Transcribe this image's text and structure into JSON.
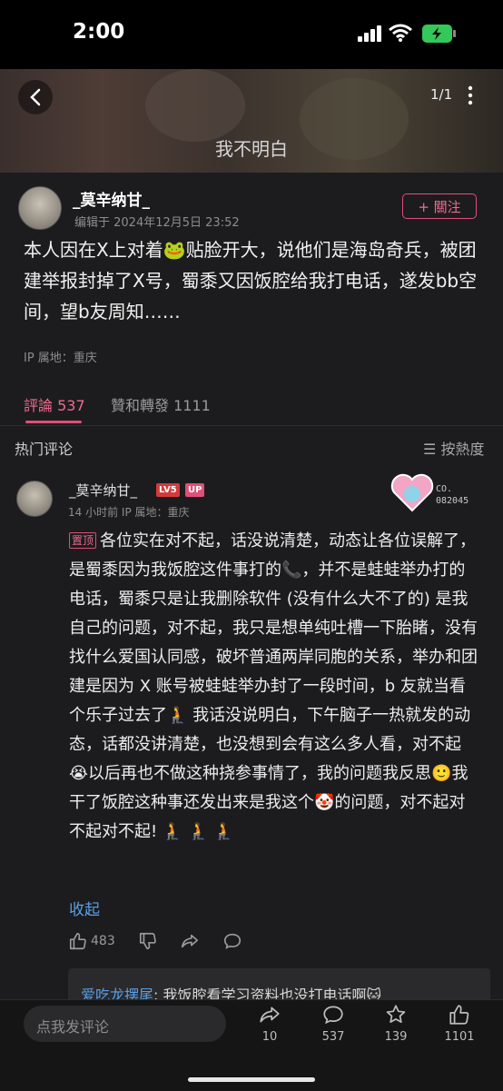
{
  "status_bar": {
    "time": "2:00"
  },
  "media": {
    "subtitle": "我不明白",
    "counter": "1/1"
  },
  "author": {
    "name": "_莫辛纳甘_",
    "edit_time": "编辑于 2024年12月5日 23:52",
    "follow_label": "+ 關注"
  },
  "post": {
    "text": "本人因在X上对着🐸贴脸开大，说他们是海岛奇兵，被团建举报封掉了X号，蜀黍又因饭腔给我打电话，遂发bb空间，望b友周知……",
    "ip": "IP 属地：重庆"
  },
  "tabs": {
    "comments": "評論 537",
    "likes_reposts": "贊和轉發 1111"
  },
  "hot_comments": {
    "label": "热门评论",
    "sort_label": "按熱度"
  },
  "comment": {
    "user": "_莫辛纳甘_",
    "level": "LV5",
    "up_badge": "UP",
    "meta": "14 小时前  IP 属地：重庆",
    "deco_text_1": "CO.",
    "deco_text_2": "082045",
    "pin_label": "置顶",
    "body": "各位实在对不起，话没说清楚，动态让各位误解了，是蜀黍因为我饭腔这件事打的📞，并不是蛙蛙举办打的电话，蜀黍只是让我删除软件 (没有什么大不了的) 是我自己的问题，对不起，我只是想单纯吐槽一下胎睹，没有找什么爱国认同感，破坏普通两岸同胞的关系，举办和团建是因为 X 账号被蛙蛙举办封了一段时间，b 友就当看个乐子过去了🧎 我话没说明白，下午脑子一热就发的动态，话都没讲清楚，也没想到会有这么多人看，对不起😭以后再也不做这种挠参事情了，我的问题我反思🙂我干了饭腔这种事还发出来是我这个🤡的问题，对不起对不起对不起! 🧎 🧎 🧎",
    "collapse_label": "收起",
    "like_count": "483",
    "reply_user": "爱吃龙摆尾",
    "reply_text": ": 我饭腔看学习资料也没打电话啊🐱"
  },
  "bottom_bar": {
    "input_placeholder": "点我发评论",
    "share_count": "10",
    "comment_count": "537",
    "favorite_count": "139",
    "like_count": "1101"
  },
  "colors": {
    "accent_pink": "#e04f78",
    "link_blue": "#5aa0e6",
    "background": "#1c1c1e"
  },
  "icons": [
    "back-icon",
    "more-icon",
    "sort-icon",
    "thumb-up-icon",
    "thumb-down-icon",
    "share-icon",
    "comment-icon",
    "star-icon"
  ]
}
